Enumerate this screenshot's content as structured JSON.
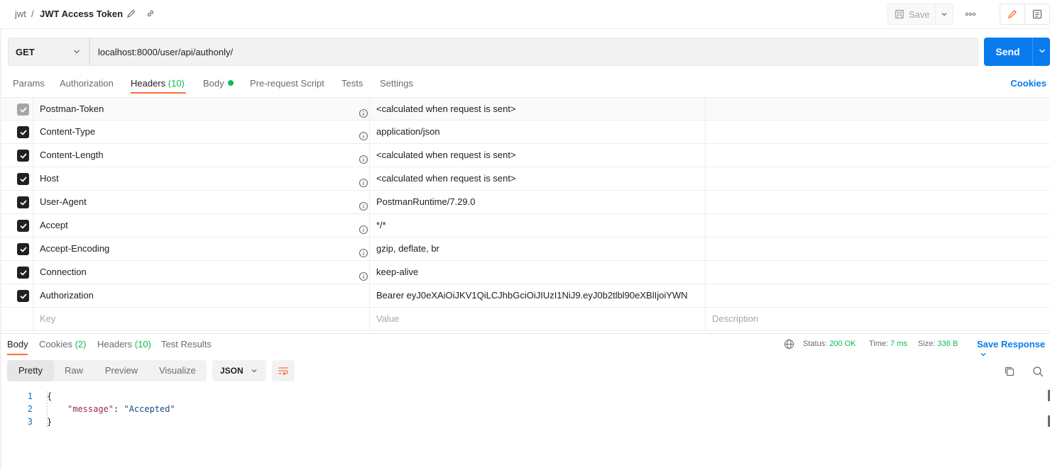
{
  "titlebar": {
    "collection": "jwt",
    "separator": "/",
    "request_name": "JWT Access Token",
    "save_label": "Save",
    "more_label": "ooo"
  },
  "request": {
    "method": "GET",
    "url": "localhost:8000/user/api/authonly/",
    "send_label": "Send"
  },
  "request_tabs": {
    "params": "Params",
    "authorization": "Authorization",
    "headers": "Headers",
    "headers_count": "(10)",
    "body": "Body",
    "pre_request": "Pre-request Script",
    "tests": "Tests",
    "settings": "Settings",
    "cookies": "Cookies"
  },
  "headers": [
    {
      "key": "Postman-Token",
      "value": "<calculated when request is sent>",
      "checked": true,
      "disabled": true,
      "info": true
    },
    {
      "key": "Content-Type",
      "value": "application/json",
      "checked": true,
      "disabled": false,
      "info": true
    },
    {
      "key": "Content-Length",
      "value": "<calculated when request is sent>",
      "checked": true,
      "disabled": false,
      "info": true
    },
    {
      "key": "Host",
      "value": "<calculated when request is sent>",
      "checked": true,
      "disabled": false,
      "info": true
    },
    {
      "key": "User-Agent",
      "value": "PostmanRuntime/7.29.0",
      "checked": true,
      "disabled": false,
      "info": true
    },
    {
      "key": "Accept",
      "value": "*/*",
      "checked": true,
      "disabled": false,
      "info": true
    },
    {
      "key": "Accept-Encoding",
      "value": "gzip, deflate, br",
      "checked": true,
      "disabled": false,
      "info": true
    },
    {
      "key": "Connection",
      "value": "keep-alive",
      "checked": true,
      "disabled": false,
      "info": true
    },
    {
      "key": "Authorization",
      "value": "Bearer eyJ0eXAiOiJKV1QiLCJhbGciOiJIUzI1NiJ9.eyJ0b2tlbl90eXBlIjoiYWN",
      "checked": true,
      "disabled": false,
      "info": false
    }
  ],
  "new_header_placeholders": {
    "key": "Key",
    "value": "Value",
    "description": "Description"
  },
  "response_tabs": {
    "body": "Body",
    "cookies": "Cookies",
    "cookies_count": "(2)",
    "headers": "Headers",
    "headers_count": "(10)",
    "test_results": "Test Results"
  },
  "response_meta": {
    "status_label": "Status:",
    "status_value": "200 OK",
    "time_label": "Time:",
    "time_value": "7 ms",
    "size_label": "Size:",
    "size_value": "336 B",
    "save_response": "Save Response"
  },
  "response_view": {
    "modes": [
      "Pretty",
      "Raw",
      "Preview",
      "Visualize"
    ],
    "active_mode": "Pretty",
    "format": "JSON"
  },
  "response_body": {
    "lines": [
      "1",
      "2",
      "3"
    ],
    "open_brace": "{",
    "key": "\"message\"",
    "colon": ": ",
    "value": "\"Accepted\"",
    "close_brace": "}"
  },
  "colors": {
    "accent": "#ff6c37",
    "primary": "#097bed",
    "success": "#0cbb52"
  }
}
